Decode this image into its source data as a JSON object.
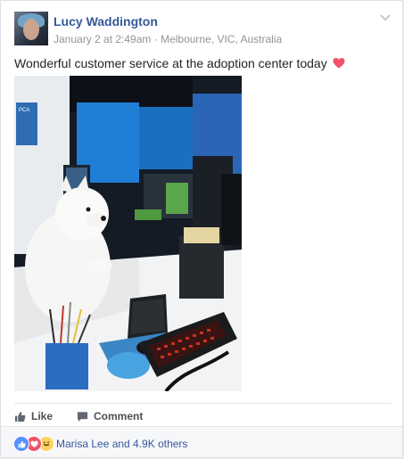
{
  "post": {
    "author": "Lucy Waddington",
    "date": "January 2 at 2:49am",
    "separator": " · ",
    "location": "Melbourne, VIC, Australia",
    "text": "Wonderful customer service at the adoption center today",
    "emoji": "heart-icon",
    "photo_sign_text": "PCA"
  },
  "actions": {
    "like_label": "Like",
    "comment_label": "Comment"
  },
  "reactions": {
    "types": [
      "like-icon",
      "love-icon",
      "haha-icon"
    ],
    "summary": "Marisa Lee and 4.9K others"
  },
  "colors": {
    "link": "#365899",
    "meta": "#90949c",
    "like": "#5890ff",
    "love": "#f25268",
    "haha": "#fcd264"
  }
}
